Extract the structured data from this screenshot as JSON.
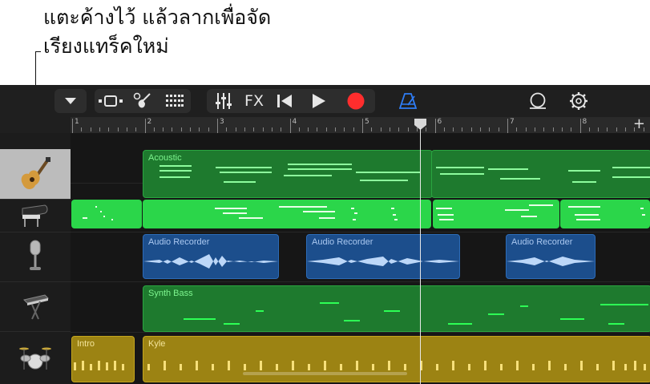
{
  "caption": {
    "line1": "แตะค้างไว้ แล้วลากเพื่อจัด",
    "line2": "เรียงแทร็คใหม่"
  },
  "toolbar": {
    "fx_label": "FX",
    "icons": [
      "chevron-down-icon",
      "tracks-view-icon",
      "smart-instrument-icon",
      "grid-view-icon",
      "mixer-icon",
      "fx-button",
      "rewind-icon",
      "play-icon",
      "record-icon",
      "metronome-icon",
      "loop-icon",
      "settings-icon"
    ],
    "colors": {
      "record": "#ff2d2d",
      "metronome": "#2f7df6",
      "icon": "#e6e6e6"
    }
  },
  "ruler": {
    "bars": [
      "1",
      "2",
      "3",
      "4",
      "5",
      "6",
      "7",
      "8"
    ],
    "add_label": "+"
  },
  "tracks": [
    {
      "id": "acoustic",
      "icon": "acoustic-guitar-icon",
      "selected": true
    },
    {
      "id": "piano",
      "icon": "grand-piano-icon"
    },
    {
      "id": "mic",
      "icon": "microphone-icon"
    },
    {
      "id": "synth",
      "icon": "keyboard-synth-icon"
    },
    {
      "id": "drums",
      "icon": "drum-kit-icon"
    }
  ],
  "regions": {
    "acoustic": "Acoustic",
    "audio1": "Audio Recorder",
    "audio2": "Audio Recorder",
    "audio3": "Audio Recorder",
    "synth": "Synth Bass",
    "intro": "Intro",
    "kyle": "Kyle"
  },
  "colors": {
    "green_dark": "#1e7a2e",
    "green_bright": "#2bd64a",
    "audio_blue": "#1c4e8c",
    "drummer_gold": "#9c8313"
  }
}
